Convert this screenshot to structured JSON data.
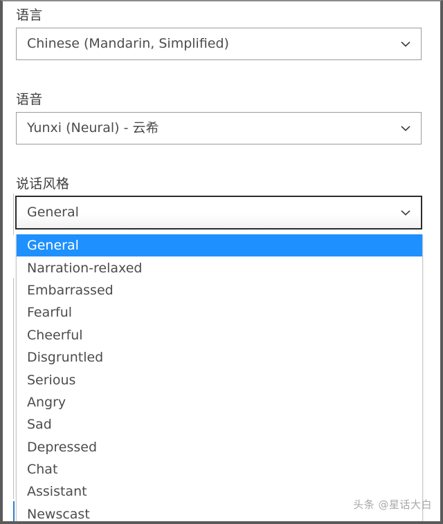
{
  "window": {
    "frame_color": "#5a5a5a",
    "background": "#ffffff"
  },
  "fields": [
    {
      "id": "language",
      "label": "语言",
      "value": "Chinese (Mandarin, Simplified)",
      "icon": "chevron-down-icon",
      "focused": false
    },
    {
      "id": "voice",
      "label": "语音",
      "value": "Yunxi (Neural) - 云希",
      "icon": "chevron-down-icon",
      "focused": false
    },
    {
      "id": "speaking-style",
      "label": "说话风格",
      "value": "General",
      "icon": "chevron-down-icon",
      "focused": true
    }
  ],
  "dropdown": {
    "open": true,
    "owner": "speaking-style",
    "selected_index": 0,
    "highlight_color": "#1e90ff",
    "highlight_text_color": "#ffffff",
    "options": [
      "General",
      "Narration-relaxed",
      "Embarrassed",
      "Fearful",
      "Cheerful",
      "Disgruntled",
      "Serious",
      "Angry",
      "Sad",
      "Depressed",
      "Chat",
      "Assistant",
      "Newscast"
    ]
  },
  "watermark": {
    "text": "头条 @星话大白"
  }
}
